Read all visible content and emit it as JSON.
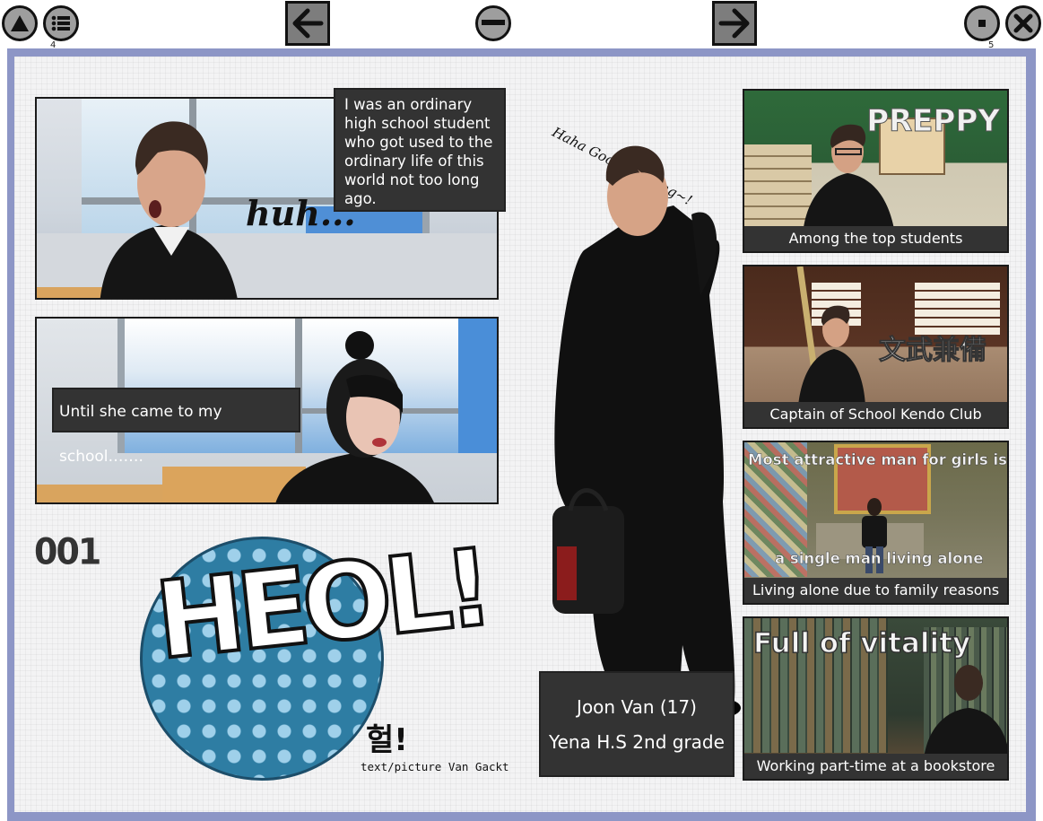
{
  "toolbar": {
    "up_icon": "triangle-up-icon",
    "menu_icon": "list-icon",
    "menu_badge": "4",
    "prev_icon": "arrow-left-icon",
    "zoom_out_icon": "minus-circle-icon",
    "next_icon": "arrow-right-icon",
    "single_page_icon": "dot-icon",
    "single_page_badge": "5",
    "close_icon": "close-icon"
  },
  "comic": {
    "panel1": {
      "caption": "I was an ordinary high school student who got used to the ordinary life of this world not too long ago.",
      "sfx": "huh..."
    },
    "panel2": {
      "caption": "Until she came to my school……."
    },
    "chapter_number": "001",
    "logo": {
      "letters": "HEOL!",
      "korean": "헐!",
      "credit": "text/picture Van Gackt"
    },
    "speech": "Haha Good morning~!",
    "character": {
      "name_line": "Joon Van (17)",
      "school_line": "Yena H.S 2nd grade"
    },
    "traits": [
      {
        "overlay": "PREPPY",
        "caption": "Among the top students"
      },
      {
        "overlay": "文武兼備",
        "caption": "Captain of School Kendo Club"
      },
      {
        "overlay_top": "Most attractive man for girls is",
        "overlay_bottom": "a single man living alone",
        "caption": "Living alone due to family reasons"
      },
      {
        "overlay": "Full of vitality",
        "caption": "Working part-time at a bookstore"
      }
    ]
  },
  "colors": {
    "page_border": "#8d96c6",
    "caption_bg": "#333333",
    "logo_blue": "#2e7da3"
  }
}
